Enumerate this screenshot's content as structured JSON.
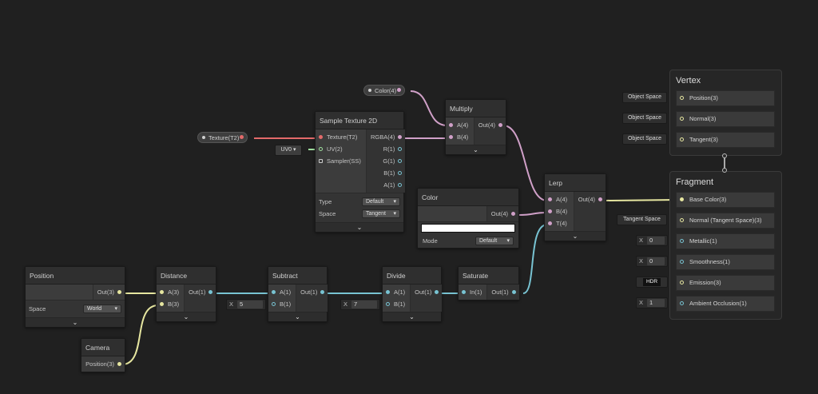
{
  "properties": [
    {
      "label": "Color(4)"
    },
    {
      "label": "Texture(T2)"
    }
  ],
  "nodes": {
    "sample_texture": {
      "title": "Sample Texture 2D",
      "inputs": [
        "Texture(T2)",
        "UV(2)",
        "Sampler(SS)"
      ],
      "outputs": [
        "RGBA(4)",
        "R(1)",
        "G(1)",
        "B(1)",
        "A(1)"
      ],
      "settings": [
        {
          "label": "Type",
          "value": "Default"
        },
        {
          "label": "Space",
          "value": "Tangent"
        }
      ],
      "uv_dropdown": "UV0"
    },
    "multiply": {
      "title": "Multiply",
      "inputs": [
        "A(4)",
        "B(4)"
      ],
      "outputs": [
        "Out(4)"
      ]
    },
    "color": {
      "title": "Color",
      "outputs": [
        "Out(4)"
      ],
      "swatch_color": "#ffffff",
      "mode_label": "Mode",
      "mode_value": "Default"
    },
    "lerp": {
      "title": "Lerp",
      "inputs": [
        "A(4)",
        "B(4)",
        "T(4)"
      ],
      "outputs": [
        "Out(4)"
      ]
    },
    "position": {
      "title": "Position",
      "outputs": [
        "Out(3)"
      ],
      "space_label": "Space",
      "space_value": "World"
    },
    "camera": {
      "title": "Camera",
      "outputs": [
        "Position(3)"
      ]
    },
    "distance": {
      "title": "Distance",
      "inputs": [
        "A(3)",
        "B(3)"
      ],
      "outputs": [
        "Out(1)"
      ]
    },
    "subtract": {
      "title": "Subtract",
      "inputs": [
        "A(1)",
        "B(1)"
      ],
      "outputs": [
        "Out(1)"
      ],
      "b_value": "5"
    },
    "divide": {
      "title": "Divide",
      "inputs": [
        "A(1)",
        "B(1)"
      ],
      "outputs": [
        "Out(1)"
      ],
      "b_value": "7"
    },
    "saturate": {
      "title": "Saturate",
      "inputs": [
        "In(1)"
      ],
      "outputs": [
        "Out(1)"
      ]
    }
  },
  "vertex": {
    "title": "Vertex",
    "blocks": [
      {
        "label": "Position(3)",
        "context": "Object Space"
      },
      {
        "label": "Normal(3)",
        "context": "Object Space"
      },
      {
        "label": "Tangent(3)",
        "context": "Object Space"
      }
    ]
  },
  "fragment": {
    "title": "Fragment",
    "blocks": [
      {
        "label": "Base Color(3)"
      },
      {
        "label": "Normal (Tangent Space)(3)",
        "context": "Tangent Space"
      },
      {
        "label": "Metallic(1)",
        "axis": "X",
        "value": "0"
      },
      {
        "label": "Smoothness(1)",
        "axis": "X",
        "value": "0"
      },
      {
        "label": "Emission(3)",
        "context": "HDR"
      },
      {
        "label": "Ambient Occlusion(1)",
        "axis": "X",
        "value": "1"
      }
    ]
  },
  "colors": {
    "wire_vector4": "#d0a0c8",
    "wire_vector3": "#e6e6a0",
    "wire_vector1": "#78c3d2",
    "wire_texture": "#e36a6a",
    "wire_vector2": "#9fe09f"
  },
  "glyphs": {
    "chevron": "⌄",
    "dropdown_arrow": "▾"
  }
}
